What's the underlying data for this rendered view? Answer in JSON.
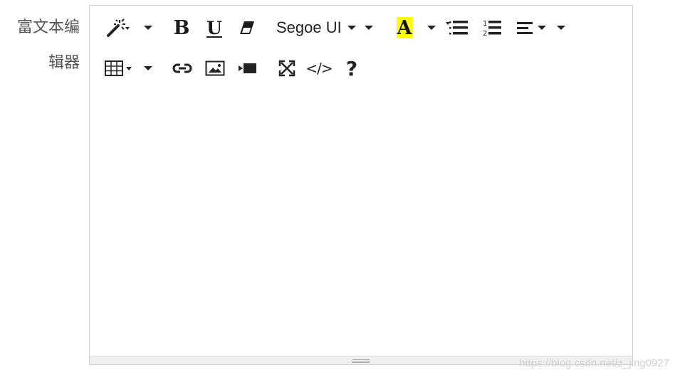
{
  "form": {
    "label": "富文本编辑器"
  },
  "toolbar": {
    "font_name": "Segoe UI",
    "font_color_letter": "A",
    "bold_letter": "B",
    "underline_letter": "U",
    "code_view_text": "</>",
    "help_text": "?",
    "highlight_color": "#ffff00"
  },
  "editor": {
    "content": ""
  },
  "watermark": {
    "text": "https://blog.csdn.net/z_jing0927"
  }
}
